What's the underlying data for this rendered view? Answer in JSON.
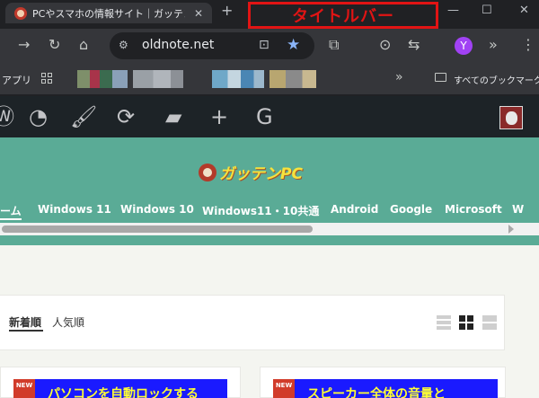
{
  "browser": {
    "tab_title": "PCやスマホの情報サイト｜ガッテンP",
    "annotation": "タイトルバー",
    "url": "oldnote.net",
    "profile_initial": "Y",
    "bookmarks": {
      "apps_label": "アプリ",
      "all_bookmarks": "すべてのブックマーク"
    }
  },
  "site": {
    "logo_text": "ガッテンPC",
    "nav": [
      "ーム",
      "Windows 11",
      "Windows 10",
      "Windows11・10共通",
      "Android",
      "Google",
      "Microsoft",
      "W"
    ],
    "sort_tabs": [
      "新着順",
      "人気順"
    ],
    "posts": [
      {
        "badge": "NEW",
        "title": "パソコンを自動ロックする"
      },
      {
        "badge": "NEW",
        "title": "スピーカー全体の音量と"
      }
    ]
  },
  "colors": {
    "header_bg": "#5aab96",
    "admin_bar_bg": "#1d2327",
    "logo_text": "#f7e23c",
    "annotation": "#e11414",
    "badge": "#d13b2a"
  }
}
